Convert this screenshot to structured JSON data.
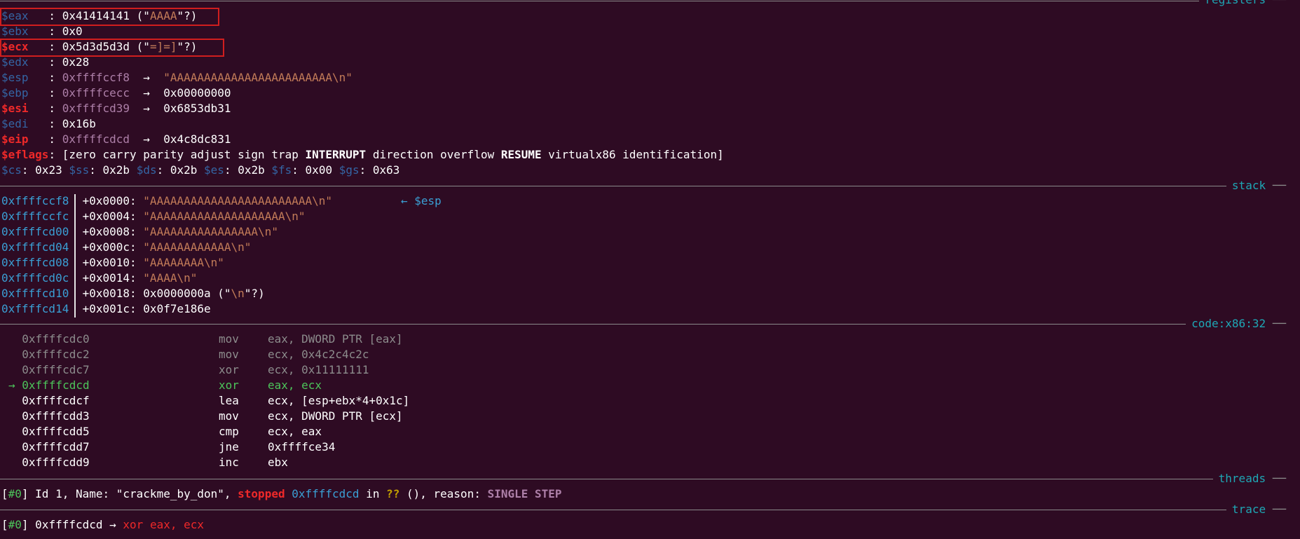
{
  "sections": {
    "registers": "registers",
    "stack": "stack",
    "code": "code:x86:32",
    "threads": "threads",
    "trace": "trace"
  },
  "registers": [
    {
      "name": "$eax",
      "pad": "   : ",
      "value": "0x41414141",
      "tail_open": " (\"",
      "tail_str": "AAAA",
      "tail_close": "\"?)"
    },
    {
      "name": "$ebx",
      "pad": "   : ",
      "value": "0x0"
    },
    {
      "name": "$ecx",
      "pad": "   : ",
      "value": "0x5d3d5d3d",
      "tail_open": " (\"",
      "tail_str": "=]=]",
      "tail_close": "\"?)"
    },
    {
      "name": "$edx",
      "pad": "   : ",
      "value": "0x28"
    },
    {
      "name": "$esp",
      "pad": "   : ",
      "ptr": "0xffffccf8",
      "arrow": "  →  ",
      "deref": "\"AAAAAAAAAAAAAAAAAAAAAAAA\\n\""
    },
    {
      "name": "$ebp",
      "pad": "   : ",
      "ptr": "0xffffcecc",
      "arrow": "  →  ",
      "deref": "0x00000000"
    },
    {
      "name": "$esi",
      "pad": "   : ",
      "ptr": "0xffffcd39",
      "arrow": "  →  ",
      "deref": "0x6853db31"
    },
    {
      "name": "$edi",
      "pad": "   : ",
      "value": "0x16b"
    },
    {
      "name": "$eip",
      "pad": "   : ",
      "ptr": "0xffffcdcd",
      "arrow": "  →  ",
      "deref": "0x4c8dc831"
    }
  ],
  "eflags": {
    "name": "$eflags",
    "open": ": [zero carry parity adjust sign trap ",
    "interrupt": "INTERRUPT",
    "mid": " direction overflow ",
    "resume": "RESUME",
    "close": " virtualx86 identification]"
  },
  "segments": [
    {
      "name": "$cs",
      "val": ": 0x23 "
    },
    {
      "name": "$ss",
      "val": ": 0x2b "
    },
    {
      "name": "$ds",
      "val": ": 0x2b "
    },
    {
      "name": "$es",
      "val": ": 0x2b "
    },
    {
      "name": "$fs",
      "val": ": 0x00 "
    },
    {
      "name": "$gs",
      "val": ": 0x63"
    }
  ],
  "stack": [
    {
      "addr": "0xffffccf8",
      "off": "+0x0000: ",
      "val": "\"AAAAAAAAAAAAAAAAAAAAAAAA\\n\"",
      "tag": "← $esp"
    },
    {
      "addr": "0xffffccfc",
      "off": "+0x0004: ",
      "val": "\"AAAAAAAAAAAAAAAAAAAA\\n\""
    },
    {
      "addr": "0xffffcd00",
      "off": "+0x0008: ",
      "val": "\"AAAAAAAAAAAAAAAA\\n\""
    },
    {
      "addr": "0xffffcd04",
      "off": "+0x000c: ",
      "val": "\"AAAAAAAAAAAA\\n\""
    },
    {
      "addr": "0xffffcd08",
      "off": "+0x0010: ",
      "val": "\"AAAAAAAA\\n\""
    },
    {
      "addr": "0xffffcd0c",
      "off": "+0x0014: ",
      "val": "\"AAAA\\n\""
    },
    {
      "addr": "0xffffcd10",
      "off": "+0x0018: ",
      "plain": "0x0000000a (\"",
      "nl": "\\n",
      "plain2": "\"?)"
    },
    {
      "addr": "0xffffcd14",
      "off": "+0x001c: ",
      "plain": "0x0f7e186e"
    }
  ],
  "code": [
    {
      "marker": "  ",
      "addr": "0xffffcdc0",
      "mn": "mov",
      "ops": "eax, DWORD PTR [eax]",
      "state": "past"
    },
    {
      "marker": "  ",
      "addr": "0xffffcdc2",
      "mn": "mov",
      "ops": "ecx, 0x4c2c4c2c",
      "state": "past"
    },
    {
      "marker": "  ",
      "addr": "0xffffcdc7",
      "mn": "xor",
      "ops": "ecx, 0x11111111",
      "state": "past"
    },
    {
      "marker": "→ ",
      "addr": "0xffffcdcd",
      "mn": "xor",
      "ops": "eax, ecx",
      "state": "current"
    },
    {
      "marker": "  ",
      "addr": "0xffffcdcf",
      "mn": "lea",
      "ops": "ecx, [esp+ebx*4+0x1c]",
      "state": "next"
    },
    {
      "marker": "  ",
      "addr": "0xffffcdd3",
      "mn": "mov",
      "ops": "ecx, DWORD PTR [ecx]",
      "state": "next"
    },
    {
      "marker": "  ",
      "addr": "0xffffcdd5",
      "mn": "cmp",
      "ops": "ecx, eax",
      "state": "next"
    },
    {
      "marker": "  ",
      "addr": "0xffffcdd7",
      "mn": "jne",
      "ops": "0xffffce34",
      "state": "next"
    },
    {
      "marker": "  ",
      "addr": "0xffffcdd9",
      "mn": "inc",
      "ops": "ebx",
      "state": "next"
    }
  ],
  "thread": {
    "open": "[",
    "id": "#0",
    "mid": "] Id 1, Name: \"crackme_by_don\", ",
    "stopped": "stopped",
    "sp": " ",
    "pc": "0xffffcdcd",
    "in": " in ",
    "func": "??",
    "reason_lbl": " (), reason: ",
    "reason": "SINGLE STEP"
  },
  "trace": {
    "open": "[",
    "id": "#0",
    "mid": "] 0xffffcdcd → ",
    "ins": "xor eax, ecx"
  },
  "colors": {
    "background": "#2e0b23",
    "changed_register": "#ef2929",
    "register": "#3465a4",
    "pointer": "#ad7fa8",
    "string": "#c4a000",
    "section_title": "#1ea7b5",
    "highlight_box": "#d01e1e"
  }
}
